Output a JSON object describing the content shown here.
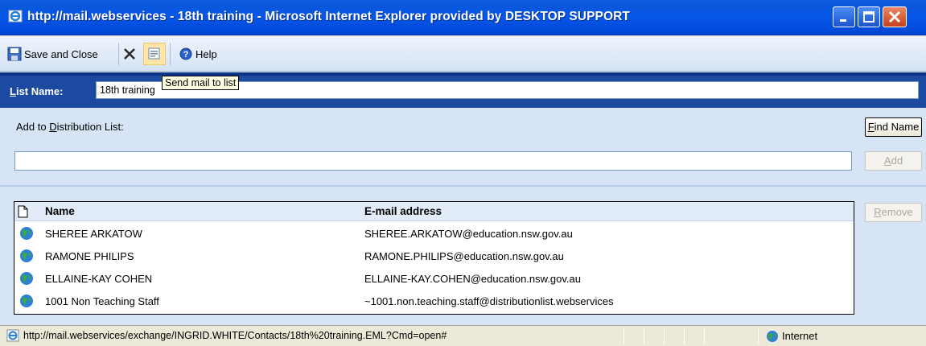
{
  "window": {
    "title": "http://mail.webservices - 18th training - Microsoft Internet Explorer provided by DESKTOP SUPPORT"
  },
  "toolbar": {
    "save_close_label": "Save and Close",
    "help_label": "Help"
  },
  "tooltip": {
    "text": "Send mail to list"
  },
  "list_name": {
    "label_first": "L",
    "label_rest": "ist Name:",
    "value": "18th training"
  },
  "distribution": {
    "label_prefix": "Add to ",
    "label_accel": "D",
    "label_rest": "istribution List:",
    "find_name_accel": "F",
    "find_name_rest": "ind Name",
    "add_accel": "A",
    "add_rest": "dd",
    "remove_accel": "R",
    "remove_rest": "emove",
    "input_value": ""
  },
  "grid": {
    "headers": {
      "name": "Name",
      "email": "E-mail address"
    },
    "rows": [
      {
        "name": "SHEREE ARKATOW",
        "email": "SHEREE.ARKATOW@education.nsw.gov.au"
      },
      {
        "name": "RAMONE PHILIPS",
        "email": "RAMONE.PHILIPS@education.nsw.gov.au"
      },
      {
        "name": "ELLAINE-KAY COHEN",
        "email": "ELLAINE-KAY.COHEN@education.nsw.gov.au"
      },
      {
        "name": "1001 Non Teaching Staff",
        "email": "~1001.non.teaching.staff@distributionlist.webservices"
      }
    ]
  },
  "statusbar": {
    "url": "http://mail.webservices/exchange/INGRID.WHITE/Contacts/18th%20training.EML?Cmd=open#",
    "zone": "Internet"
  },
  "colors": {
    "titlebar": "#0656e8",
    "listbar": "#1c4aa0",
    "content_bg": "#d6e4f5",
    "grid_header": "#e2ebf8"
  },
  "icons": [
    "ie-icon",
    "minimize-icon",
    "maximize-icon",
    "close-icon",
    "save-icon",
    "delete-icon",
    "send-mail-icon",
    "help-icon",
    "document-icon",
    "globe-icon",
    "internet-zone-icon"
  ]
}
